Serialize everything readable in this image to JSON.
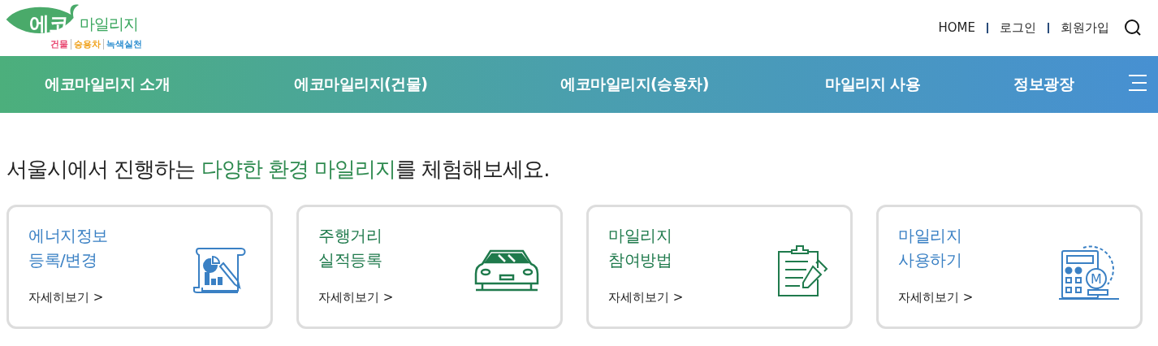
{
  "logo": {
    "main": "에코",
    "sub": "마일리지",
    "tags": [
      {
        "label": "건물",
        "color": "#e8456f"
      },
      {
        "label": "승용차",
        "color": "#f0a21c"
      },
      {
        "label": "녹색실천",
        "color": "#2f8fd0"
      }
    ]
  },
  "top_links": [
    "HOME",
    "로그인",
    "회원가입"
  ],
  "nav": [
    "에코마일리지 소개",
    "에코마일리지(건물)",
    "에코마일리지(승용차)",
    "마일리지 사용",
    "정보광장"
  ],
  "headline": {
    "before": "서울시에서 진행하는 ",
    "highlight": "다양한 환경 마일리지",
    "after": "를 체험해보세요."
  },
  "cards": [
    {
      "title": [
        "에너지정보",
        "등록/변경"
      ],
      "link": "자세히보기 >",
      "color": "#3a80c4",
      "kind": "document"
    },
    {
      "title": [
        "주행거리",
        "실적등록"
      ],
      "link": "자세히보기 >",
      "color": "#1f7a4c",
      "kind": "car"
    },
    {
      "title": [
        "마일리지",
        "참여방법"
      ],
      "link": "자세히보기 >",
      "color": "#1f7a4c",
      "kind": "clipboard"
    },
    {
      "title": [
        "마일리지",
        "사용하기"
      ],
      "link": "자세히보기 >",
      "color": "#3a80c4",
      "kind": "calculator",
      "icon_letter": "M"
    }
  ]
}
